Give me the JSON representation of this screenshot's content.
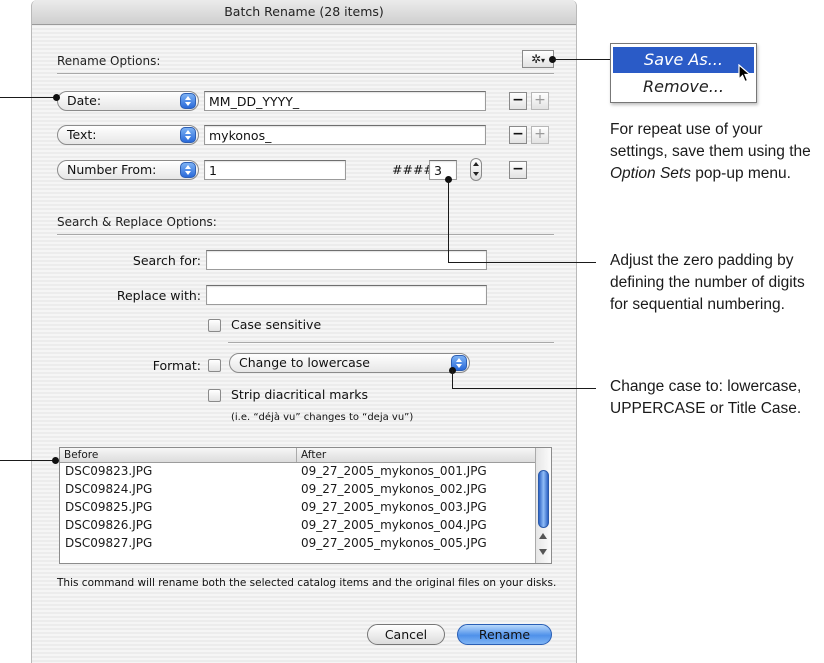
{
  "dialog": {
    "title": "Batch Rename (28 items)",
    "rename_options_label": "Rename Options:",
    "gear_button": "✲",
    "rows": [
      {
        "popup": "Date:",
        "value": "MM_DD_YYYY_"
      },
      {
        "popup": "Text:",
        "value": "mykonos_"
      },
      {
        "popup": "Number From:",
        "value": "1"
      }
    ],
    "minus": "−",
    "plus": "+",
    "digits_label": "####:",
    "digits_value": "3",
    "search_replace_label": "Search & Replace Options:",
    "search_for_label": "Search for:",
    "search_for_value": "",
    "replace_with_label": "Replace with:",
    "replace_with_value": "",
    "case_sensitive_label": "Case sensitive",
    "format_label": "Format:",
    "format_value": "Change to lowercase",
    "strip_label": "Strip diacritical marks",
    "strip_note": "(i.e. “déjà vu” changes to “deja vu”)",
    "table": {
      "headers": [
        "Before",
        "After"
      ],
      "rows": [
        [
          "DSC09823.JPG",
          "09_27_2005_mykonos_001.JPG"
        ],
        [
          "DSC09824.JPG",
          "09_27_2005_mykonos_002.JPG"
        ],
        [
          "DSC09825.JPG",
          "09_27_2005_mykonos_003.JPG"
        ],
        [
          "DSC09826.JPG",
          "09_27_2005_mykonos_004.JPG"
        ],
        [
          "DSC09827.JPG",
          "09_27_2005_mykonos_005.JPG"
        ]
      ]
    },
    "footer_note": "This command will rename both the selected catalog items and the original files on your disks.",
    "cancel_label": "Cancel",
    "rename_label": "Rename"
  },
  "option_menu": {
    "items": [
      "Save As...",
      "Remove..."
    ]
  },
  "callouts": {
    "option_sets": {
      "before": "For repeat use of your settings, save them using the ",
      "emph": "Option Sets",
      "after": " pop-up menu."
    },
    "zero_padding": "Adjust the zero padding by defining the number of digits for sequential numbering.",
    "change_case": "Change case to: lowercase, UPPERCASE or Title Case."
  },
  "colors": {
    "accent_blue": "#2a5bc7",
    "dialog_bg": "#ececec"
  }
}
